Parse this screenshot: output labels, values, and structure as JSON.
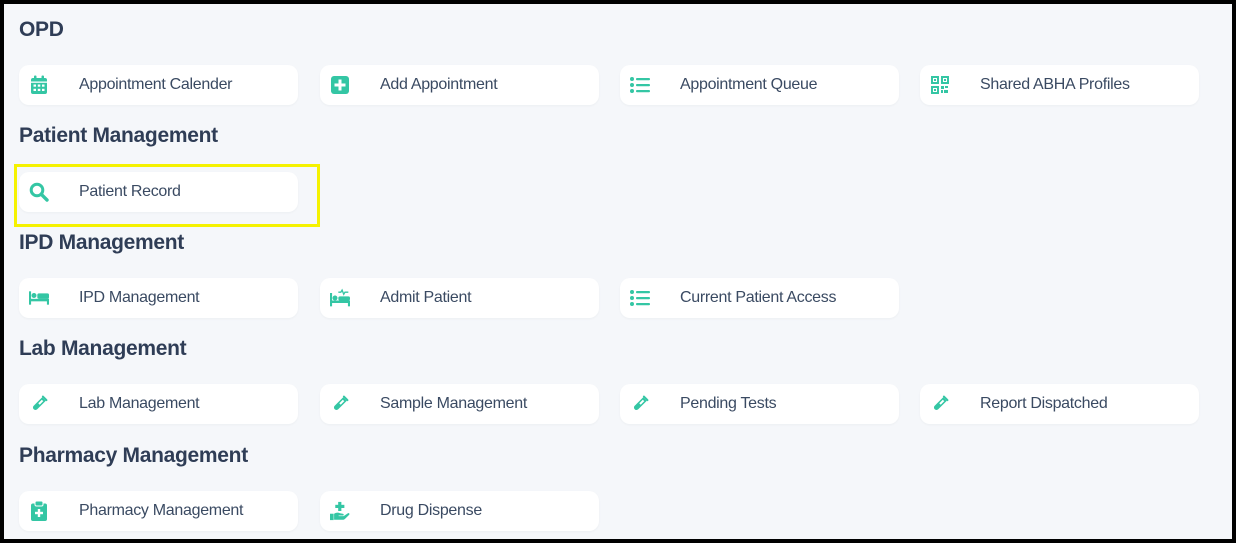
{
  "accent_color": "#34c6a4",
  "highlight_color": "#f5f200",
  "sections": {
    "opd": {
      "title": "OPD",
      "items": [
        {
          "label": "Appointment Calender",
          "icon": "calendar-icon"
        },
        {
          "label": "Add Appointment",
          "icon": "plus-square-icon"
        },
        {
          "label": "Appointment Queue",
          "icon": "list-icon"
        },
        {
          "label": "Shared ABHA Profiles",
          "icon": "qr-code-icon"
        }
      ]
    },
    "patient": {
      "title": "Patient Management",
      "items": [
        {
          "label": "Patient Record",
          "icon": "search-icon"
        }
      ]
    },
    "ipd": {
      "title": "IPD Management",
      "items": [
        {
          "label": "IPD Management",
          "icon": "bed-icon"
        },
        {
          "label": "Admit Patient",
          "icon": "bed-pulse-icon"
        },
        {
          "label": "Current Patient Access",
          "icon": "list-icon"
        }
      ]
    },
    "lab": {
      "title": "Lab Management",
      "items": [
        {
          "label": "Lab Management",
          "icon": "test-tube-icon"
        },
        {
          "label": "Sample Management",
          "icon": "test-tube-icon"
        },
        {
          "label": "Pending Tests",
          "icon": "test-tube-icon"
        },
        {
          "label": "Report Dispatched",
          "icon": "test-tube-icon"
        }
      ]
    },
    "pharmacy": {
      "title": "Pharmacy Management",
      "items": [
        {
          "label": "Pharmacy Management",
          "icon": "clipboard-medical-icon"
        },
        {
          "label": "Drug Dispense",
          "icon": "hand-holding-medical-icon"
        }
      ]
    }
  }
}
